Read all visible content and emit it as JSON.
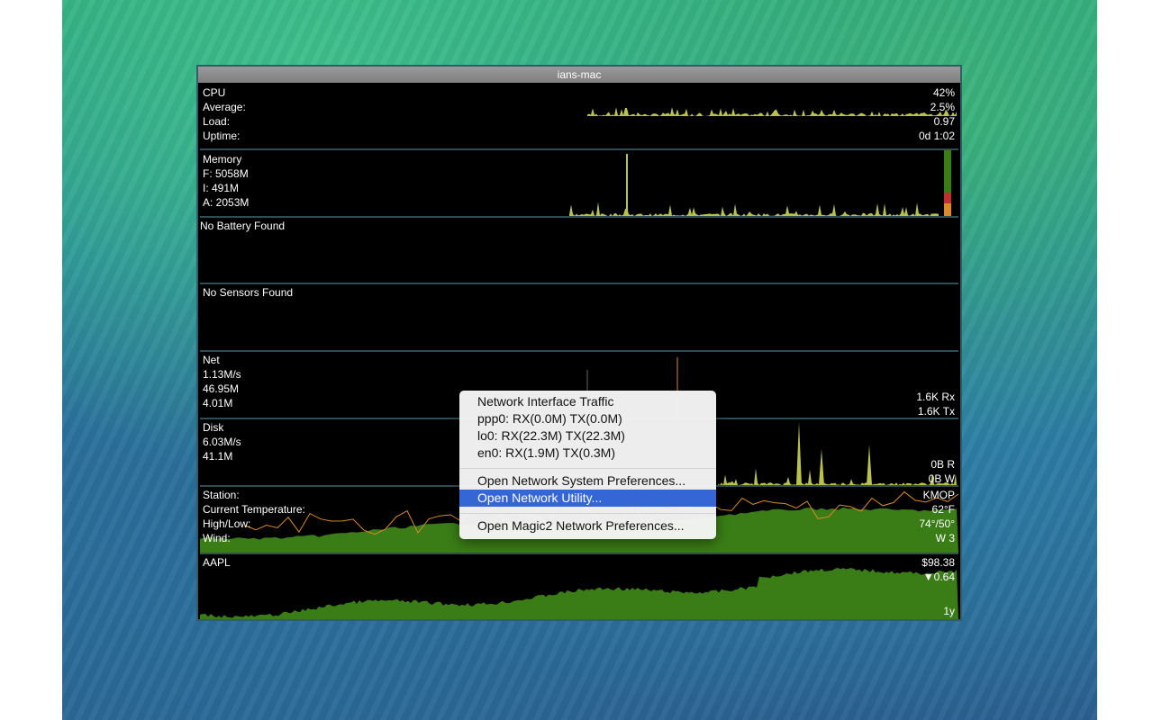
{
  "window": {
    "title": "ians-mac"
  },
  "cpu": {
    "label": "CPU",
    "average_label": "Average:",
    "load_label": "Load:",
    "uptime_label": "Uptime:",
    "percent": "42%",
    "average": "2.5%",
    "load": "0.97",
    "uptime": "0d 1:02"
  },
  "memory": {
    "label": "Memory",
    "free": "F: 5058M",
    "inactive": "I: 491M",
    "active": "A: 2053M"
  },
  "battery": {
    "label": "No Battery Found"
  },
  "sensors": {
    "label": "No Sensors Found"
  },
  "net": {
    "label": "Net",
    "rate": "1.13M/s",
    "total": "46.95M",
    "other": "4.01M",
    "rx": "1.6K Rx",
    "tx": "1.6K Tx"
  },
  "disk": {
    "label": "Disk",
    "rate": "6.03M/s",
    "total": "41.1M",
    "read": "0B R",
    "write": "0B W"
  },
  "weather": {
    "station_label": "Station:",
    "temp_label": "Current Temperature:",
    "highlow_label": "High/Low:",
    "wind_label": "Wind:",
    "station": "KMOP",
    "temp": "62°F",
    "highlow": "74°/50°",
    "wind": "W 3"
  },
  "stock": {
    "symbol": "AAPL",
    "price": "$98.38",
    "change": "▼0.64",
    "range": "1y"
  },
  "menu": {
    "header": "Network Interface Traffic",
    "interfaces": [
      "ppp0: RX(0.0M) TX(0.0M)",
      "lo0: RX(22.3M) TX(22.3M)",
      "en0: RX(1.9M) TX(0.3M)"
    ],
    "open_system_prefs": "Open Network System Preferences...",
    "open_network_utility": "Open Network Utility...",
    "open_magic_prefs": "Open Magic2 Network Preferences..."
  },
  "colors": {
    "graph_green": "#3a7d16",
    "graph_yellow": "#b9c24a",
    "graph_orange": "#d98a2a",
    "menu_highlight": "#3566d6"
  }
}
